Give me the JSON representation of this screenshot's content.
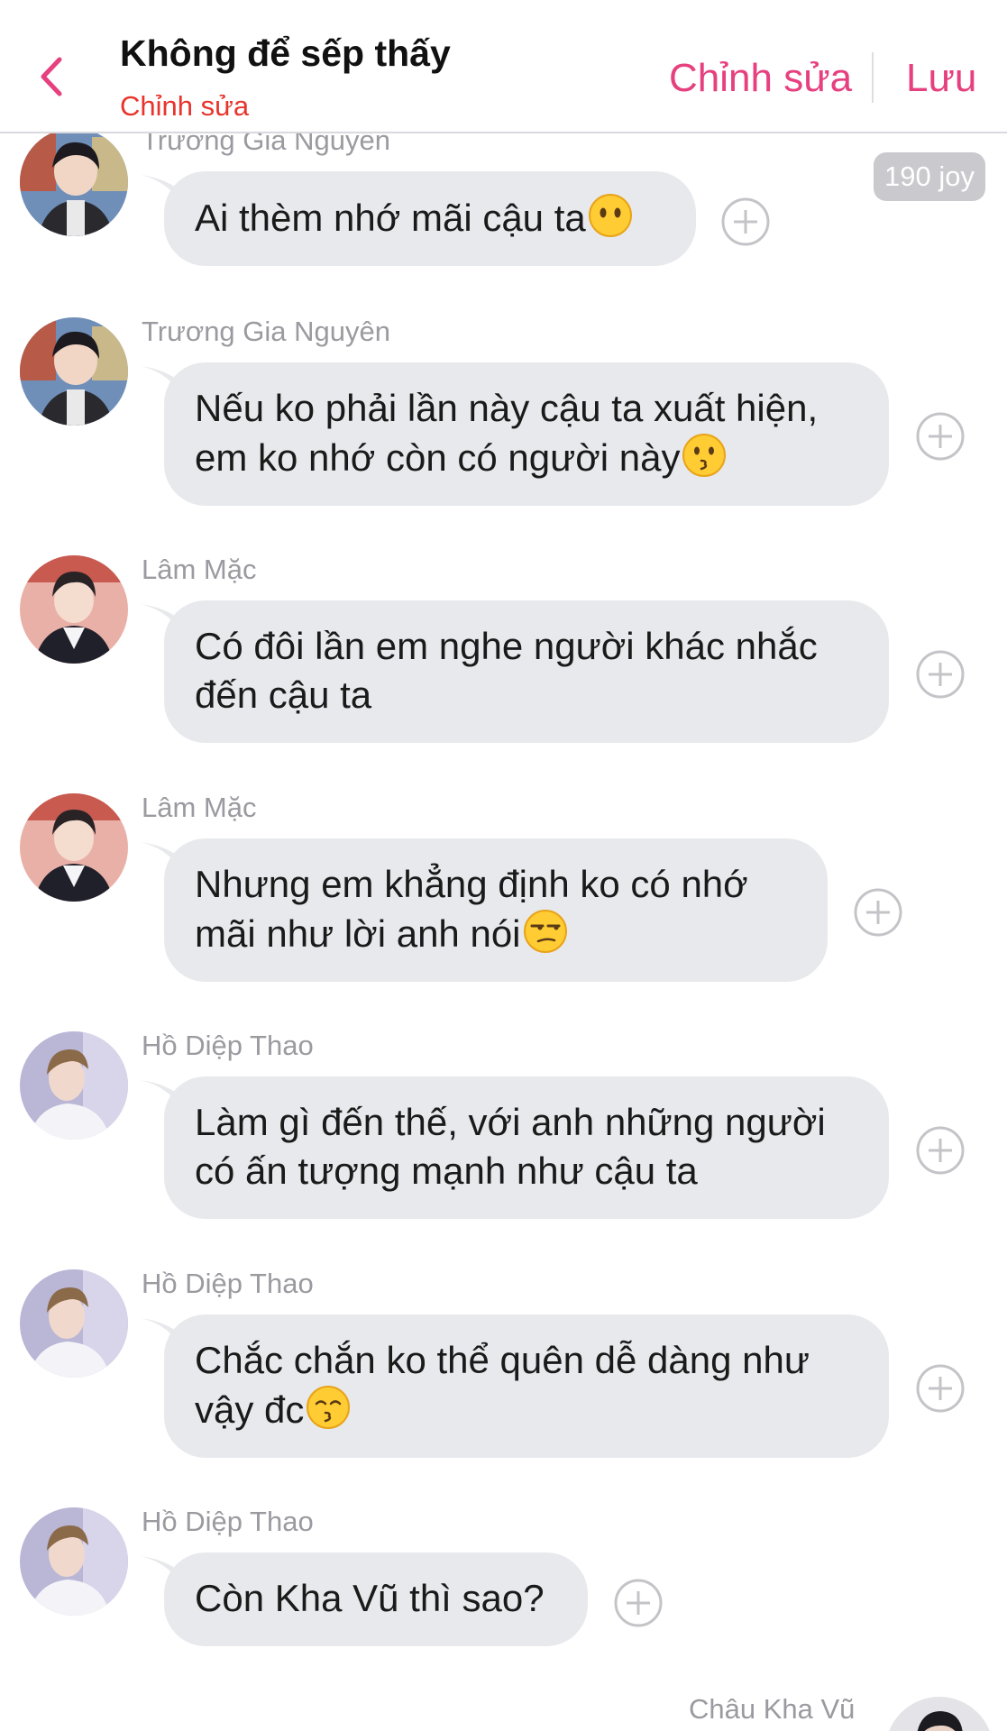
{
  "header": {
    "title": "Không để sếp thấy",
    "subtitle": "Chỉnh sửa",
    "edit_label": "Chỉnh sửa",
    "save_label": "Lưu",
    "accent_color": "#e6407f",
    "subtitle_color": "#e8342c"
  },
  "badge": {
    "label": "190 joy"
  },
  "messages": [
    {
      "sender": "Trương Gia Nguyên",
      "lines": [
        "Ai thèm nhớ mãi cậu ta"
      ],
      "emoji": "no-mouth-face"
    },
    {
      "sender": "Trương Gia Nguyên",
      "lines": [
        "Nếu ko phải lần này cậu ta xuất hiện,",
        "em ko nhớ còn có người này"
      ],
      "emoji": "kissing-face"
    },
    {
      "sender": "Lâm Mặc",
      "lines": [
        "Có đôi lần em nghe người khác nhắc",
        "đến cậu ta"
      ],
      "emoji": ""
    },
    {
      "sender": "Lâm Mặc",
      "lines": [
        "Nhưng em khẳng định ko có nhớ",
        "mãi như lời anh nói"
      ],
      "emoji": "unamused-face"
    },
    {
      "sender": "Hồ Diệp Thao",
      "lines": [
        "Làm gì đến thế, với anh những người",
        "có ấn tượng mạnh như cậu ta"
      ],
      "emoji": ""
    },
    {
      "sender": "Hồ Diệp Thao",
      "lines": [
        "Chắc chắn ko thể quên dễ dàng như",
        "vậy đc"
      ],
      "emoji": "kissing-smiling-eyes-face"
    },
    {
      "sender": "Hồ Diệp Thao",
      "lines": [
        "Còn Kha Vũ thì sao?"
      ],
      "emoji": ""
    }
  ],
  "last_sender": {
    "name": "Châu Kha Vũ"
  },
  "colors": {
    "bubble": "#e7e9ec",
    "sender_text": "#9a9aa0"
  }
}
